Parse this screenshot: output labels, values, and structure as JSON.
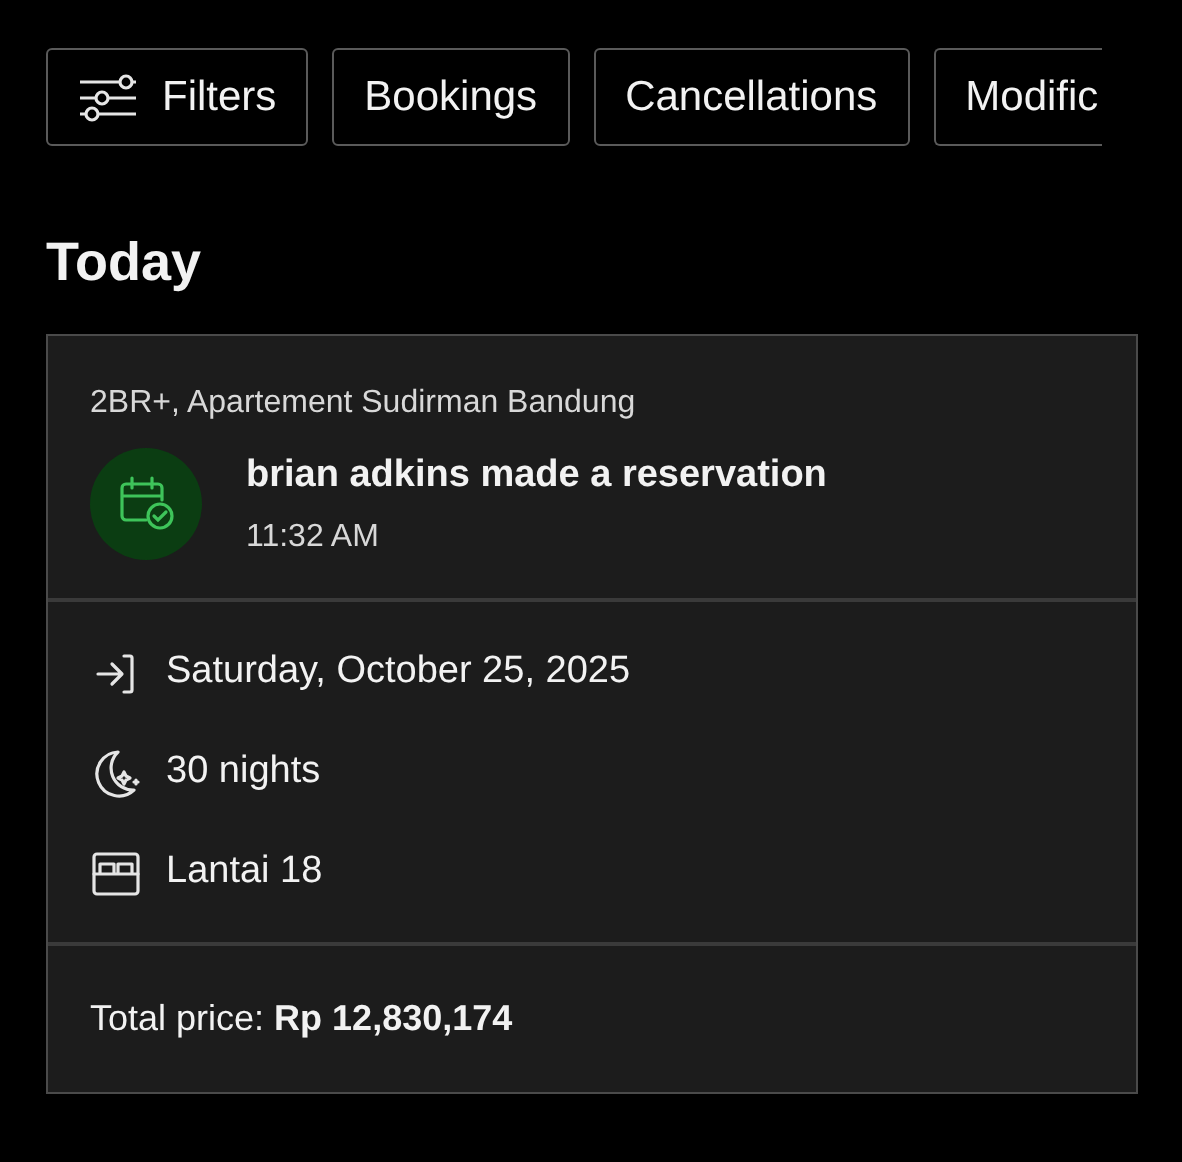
{
  "chips": [
    {
      "kind": "filters",
      "label": "Filters"
    },
    {
      "kind": "plain",
      "label": "Bookings"
    },
    {
      "kind": "plain",
      "label": "Cancellations"
    },
    {
      "kind": "cut",
      "label": "Modific"
    }
  ],
  "section_title": "Today",
  "card": {
    "property": "2BR+, Apartement Sudirman Bandung",
    "event": "brian adkins made a reservation",
    "time": "11:32 AM",
    "details": [
      {
        "kind": "checkin",
        "text": "Saturday, October 25, 2025"
      },
      {
        "kind": "nights",
        "text": "30 nights"
      },
      {
        "kind": "room",
        "text": "Lantai 18"
      }
    ],
    "price": "Total price: **Rp 12,830,174**"
  }
}
